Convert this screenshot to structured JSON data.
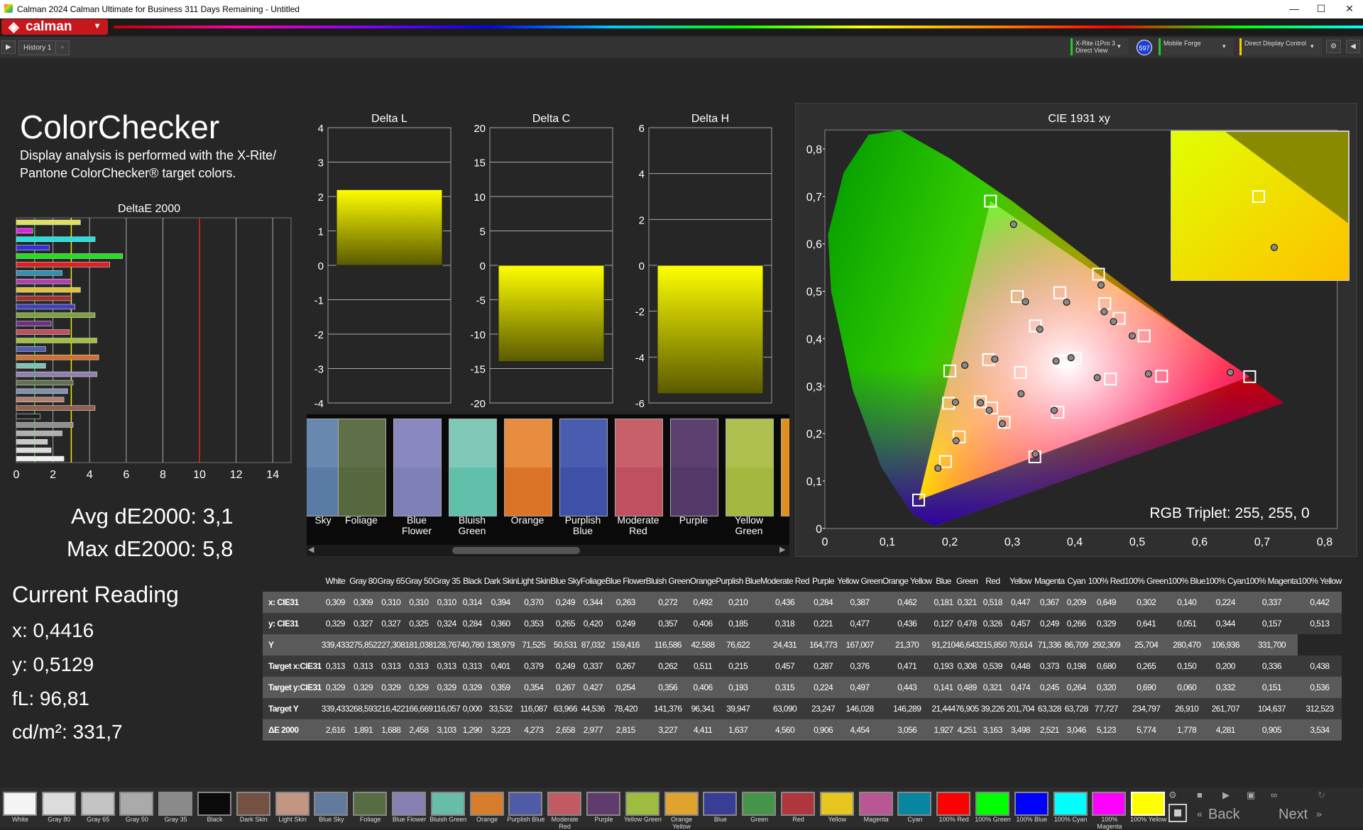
{
  "window": {
    "title": "Calman 2024 Calman Ultimate for Business 311 Days Remaining  - Untitled",
    "minimize": "—",
    "maximize": "☐",
    "close": "✕"
  },
  "app": {
    "logo_text": "calman",
    "history_tab": "History 1",
    "add_tab": "+"
  },
  "devices": {
    "meter_line1": "X-Rite i1Pro 3",
    "meter_line2": "Direct View",
    "meter_badge": "597",
    "source": "Mobile Forge",
    "display": "Direct Display Control"
  },
  "page": {
    "title": "ColorChecker",
    "description_line1": "Display analysis is performed with the X-Rite/",
    "description_line2": "Pantone ColorChecker® target colors.",
    "avg_label": "Avg dE2000: 3,1",
    "max_label": "Max dE2000: 5,8"
  },
  "current_reading": {
    "title": "Current Reading",
    "x": "x: 0,4416",
    "y": "y: 0,5129",
    "fl": "fL: 96,81",
    "cdm2": "cd/m²: 331,7"
  },
  "deltae_chart": {
    "title": "DeltaE 2000",
    "ticks": [
      "0",
      "2",
      "4",
      "6",
      "8",
      "10",
      "12",
      "14"
    ],
    "bars": [
      {
        "value": 3.5,
        "color": "#e0e060"
      },
      {
        "value": 0.9,
        "color": "#e020e0"
      },
      {
        "value": 4.3,
        "color": "#20e0e0"
      },
      {
        "value": 1.8,
        "color": "#3030e0"
      },
      {
        "value": 5.8,
        "color": "#20e020"
      },
      {
        "value": 5.1,
        "color": "#e02020"
      },
      {
        "value": 2.5,
        "color": "#3090b0"
      },
      {
        "value": 3.0,
        "color": "#b040b0"
      },
      {
        "value": 3.5,
        "color": "#e0c040"
      },
      {
        "value": 3.0,
        "color": "#a03030"
      },
      {
        "value": 3.2,
        "color": "#4040c0"
      },
      {
        "value": 4.3,
        "color": "#80a040"
      },
      {
        "value": 1.9,
        "color": "#703080"
      },
      {
        "value": 2.9,
        "color": "#c05060"
      },
      {
        "value": 4.4,
        "color": "#a0c040"
      },
      {
        "value": 1.6,
        "color": "#5060b0"
      },
      {
        "value": 4.5,
        "color": "#d07030"
      },
      {
        "value": 1.6,
        "color": "#80c0b0"
      },
      {
        "value": 4.4,
        "color": "#9080b0"
      },
      {
        "value": 3.1,
        "color": "#607050"
      },
      {
        "value": 2.8,
        "color": "#8090b0"
      },
      {
        "value": 2.6,
        "color": "#b08070"
      },
      {
        "value": 4.3,
        "color": "#906050"
      },
      {
        "value": 1.3,
        "color": "#202020"
      },
      {
        "value": 3.1,
        "color": "#909090"
      },
      {
        "value": 2.5,
        "color": "#b0b0b0"
      },
      {
        "value": 1.7,
        "color": "#c8c8c8"
      },
      {
        "value": 1.9,
        "color": "#dcdcdc"
      },
      {
        "value": 2.6,
        "color": "#f0f0f0"
      }
    ],
    "ref_lines": [
      1,
      3,
      10
    ]
  },
  "chart_data": [
    {
      "type": "bar",
      "title": "Delta L",
      "categories": [
        "100% Yellow"
      ],
      "values": [
        2.2
      ],
      "ylim": [
        -4,
        4
      ],
      "ticks": [
        "4",
        "3",
        "2",
        "1",
        "0",
        "-1",
        "-2",
        "-3",
        "-4"
      ]
    },
    {
      "type": "bar",
      "title": "Delta C",
      "categories": [
        "100% Yellow"
      ],
      "values": [
        -14
      ],
      "ylim": [
        -20,
        20
      ],
      "ticks": [
        "20",
        "15",
        "10",
        "5",
        "0",
        "-5",
        "-10",
        "-15",
        "-20"
      ]
    },
    {
      "type": "bar",
      "title": "Delta H",
      "categories": [
        "100% Yellow"
      ],
      "values": [
        -5.6
      ],
      "ylim": [
        -6,
        6
      ],
      "ticks": [
        "6",
        "4",
        "2",
        "0",
        "-2",
        "-4",
        "-6"
      ]
    },
    {
      "type": "scatter",
      "title": "CIE 1931 xy",
      "xticks": [
        "0",
        "0,1",
        "0,2",
        "0,3",
        "0,4",
        "0,5",
        "0,6",
        "0,7",
        "0,8"
      ],
      "yticks": [
        "0",
        "0,1",
        "0,2",
        "0,3",
        "0,4",
        "0,5",
        "0,6",
        "0,7",
        "0,8"
      ],
      "gamut": [
        [
          0.68,
          0.32
        ],
        [
          0.265,
          0.69
        ],
        [
          0.15,
          0.06
        ]
      ],
      "targets": [
        [
          0.313,
          0.329
        ],
        [
          0.401,
          0.359
        ],
        [
          0.379,
          0.353
        ],
        [
          0.249,
          0.267
        ],
        [
          0.337,
          0.427
        ],
        [
          0.267,
          0.254
        ],
        [
          0.262,
          0.356
        ],
        [
          0.511,
          0.406
        ],
        [
          0.215,
          0.193
        ],
        [
          0.457,
          0.315
        ],
        [
          0.287,
          0.224
        ],
        [
          0.376,
          0.497
        ],
        [
          0.471,
          0.443
        ],
        [
          0.193,
          0.141
        ],
        [
          0.308,
          0.489
        ],
        [
          0.539,
          0.321
        ],
        [
          0.448,
          0.474
        ],
        [
          0.373,
          0.245
        ],
        [
          0.198,
          0.264
        ],
        [
          0.68,
          0.32
        ],
        [
          0.265,
          0.69
        ],
        [
          0.15,
          0.06
        ],
        [
          0.2,
          0.332
        ],
        [
          0.336,
          0.151
        ],
        [
          0.438,
          0.536
        ]
      ],
      "measured": [
        [
          0.314,
          0.284
        ],
        [
          0.394,
          0.36
        ],
        [
          0.37,
          0.353
        ],
        [
          0.249,
          0.265
        ],
        [
          0.344,
          0.42
        ],
        [
          0.263,
          0.249
        ],
        [
          0.272,
          0.357
        ],
        [
          0.492,
          0.406
        ],
        [
          0.21,
          0.185
        ],
        [
          0.436,
          0.318
        ],
        [
          0.284,
          0.221
        ],
        [
          0.387,
          0.477
        ],
        [
          0.462,
          0.436
        ],
        [
          0.181,
          0.127
        ],
        [
          0.321,
          0.478
        ],
        [
          0.518,
          0.326
        ],
        [
          0.447,
          0.457
        ],
        [
          0.367,
          0.249
        ],
        [
          0.209,
          0.266
        ],
        [
          0.649,
          0.329
        ],
        [
          0.302,
          0.641
        ],
        [
          0.224,
          0.344
        ],
        [
          0.337,
          0.157
        ],
        [
          0.442,
          0.513
        ]
      ],
      "rgb_triplet": "RGB Triplet: 255, 255, 0"
    }
  ],
  "swatch_strip": [
    {
      "label1": "Sky",
      "label2": "",
      "top": "#6888b0",
      "bottom": "#5a7ca4"
    },
    {
      "label1": "Foliage",
      "label2": "",
      "top": "#5e7048",
      "bottom": "#56683e"
    },
    {
      "label1": "Blue",
      "label2": "Flower",
      "top": "#8a88c0",
      "bottom": "#7e80b8"
    },
    {
      "label1": "Bluish",
      "label2": "Green",
      "top": "#80c8b8",
      "bottom": "#60c0aa"
    },
    {
      "label1": "Orange",
      "label2": "",
      "top": "#e88c40",
      "bottom": "#dc7428"
    },
    {
      "label1": "Purplish",
      "label2": "Blue",
      "top": "#4a5cb0",
      "bottom": "#3e50a8"
    },
    {
      "label1": "Moderate",
      "label2": "Red",
      "top": "#c8606a",
      "bottom": "#c05060"
    },
    {
      "label1": "Purple",
      "label2": "",
      "top": "#5e4070",
      "bottom": "#543868"
    },
    {
      "label1": "Yellow",
      "label2": "Green",
      "top": "#b0c050",
      "bottom": "#a4b840"
    }
  ],
  "table": {
    "columns": [
      "White",
      "Gray 80",
      "Gray 65",
      "Gray 50",
      "Gray 35",
      "Black",
      "Dark Skin",
      "Light Skin",
      "Blue Sky",
      "Foliage",
      "Blue Flower",
      "Bluish Green",
      "Orange",
      "Purplish Blue",
      "Moderate Red",
      "Purple",
      "Yellow Green",
      "Orange Yellow",
      "Blue",
      "Green",
      "Red",
      "Yellow",
      "Magenta",
      "Cyan",
      "100% Red",
      "100% Green",
      "100% Blue",
      "100% Cyan",
      "100% Magenta",
      "100% Yellow"
    ],
    "rows": [
      {
        "label": "x: CIE31",
        "values": [
          "0,309",
          "0,309",
          "0,310",
          "0,310",
          "0,310",
          "0,314",
          "0,394",
          "0,370",
          "0,249",
          "0,344",
          "0,263",
          "0,272",
          "0,492",
          "0,210",
          "0,436",
          "0,284",
          "0,387",
          "0,462",
          "0,181",
          "0,321",
          "0,518",
          "0,447",
          "0,367",
          "0,209",
          "0,649",
          "0,302",
          "0,140",
          "0,224",
          "0,337",
          "0,442"
        ]
      },
      {
        "label": "y: CIE31",
        "values": [
          "0,329",
          "0,327",
          "0,327",
          "0,325",
          "0,324",
          "0,284",
          "0,360",
          "0,353",
          "0,265",
          "0,420",
          "0,249",
          "0,357",
          "0,406",
          "0,185",
          "0,318",
          "0,221",
          "0,477",
          "0,436",
          "0,127",
          "0,478",
          "0,326",
          "0,457",
          "0,249",
          "0,266",
          "0,329",
          "0,641",
          "0,051",
          "0,344",
          "0,157",
          "0,513"
        ]
      },
      {
        "label": "Y",
        "values": [
          "339,433",
          "275,852",
          "227,308",
          "181,038",
          "128,767",
          "40,780",
          "138,979",
          "71,525",
          "50,531",
          "87,032",
          "159,416",
          "116,586",
          "42,588",
          "76,622",
          "24,431",
          "164,773",
          "167,007",
          "21,370",
          "91,210",
          "46,643",
          "215,850",
          "70,614",
          "71,336",
          "86,709",
          "292,309",
          "25,704",
          "280,470",
          "106,936",
          "331,700"
        ]
      },
      {
        "label": "Target x:CIE31",
        "values": [
          "0,313",
          "0,313",
          "0,313",
          "0,313",
          "0,313",
          "0,313",
          "0,401",
          "0,379",
          "0,249",
          "0,337",
          "0,267",
          "0,262",
          "0,511",
          "0,215",
          "0,457",
          "0,287",
          "0,376",
          "0,471",
          "0,193",
          "0,308",
          "0,539",
          "0,448",
          "0,373",
          "0,198",
          "0,680",
          "0,265",
          "0,150",
          "0,200",
          "0,336",
          "0,438"
        ]
      },
      {
        "label": "Target y:CIE31",
        "values": [
          "0,329",
          "0,329",
          "0,329",
          "0,329",
          "0,329",
          "0,329",
          "0,359",
          "0,354",
          "0,267",
          "0,427",
          "0,254",
          "0,356",
          "0,406",
          "0,193",
          "0,315",
          "0,224",
          "0,497",
          "0,443",
          "0,141",
          "0,489",
          "0,321",
          "0,474",
          "0,245",
          "0,264",
          "0,320",
          "0,690",
          "0,060",
          "0,332",
          "0,151",
          "0,536"
        ]
      },
      {
        "label": "Target Y",
        "values": [
          "339,433",
          "268,593",
          "216,422",
          "166,669",
          "116,057",
          "0,000",
          "33,532",
          "116,087",
          "63,966",
          "44,536",
          "78,420",
          "141,376",
          "96,341",
          "39,947",
          "63,090",
          "23,247",
          "146,028",
          "146,289",
          "21,444",
          "76,905",
          "39,226",
          "201,704",
          "63,328",
          "63,728",
          "77,727",
          "234,797",
          "26,910",
          "261,707",
          "104,637",
          "312,523"
        ]
      },
      {
        "label": "ΔE 2000",
        "values": [
          "2,616",
          "1,891",
          "1,688",
          "2,458",
          "3,103",
          "1,290",
          "3,223",
          "4,273",
          "2,658",
          "2,977",
          "2,815",
          "3,227",
          "4,411",
          "1,637",
          "4,560",
          "0,906",
          "4,454",
          "3,056",
          "1,927",
          "4,251",
          "3,163",
          "3,498",
          "2,521",
          "3,046",
          "5,123",
          "5,774",
          "1,778",
          "4,281",
          "0,905",
          "3,534"
        ]
      }
    ]
  },
  "bottom_swatches": [
    {
      "label": "White",
      "color": "#f4f4f4"
    },
    {
      "label": "Gray 80",
      "color": "#dcdcdc"
    },
    {
      "label": "Gray 65",
      "color": "#c4c4c4"
    },
    {
      "label": "Gray 50",
      "color": "#aaaaaa"
    },
    {
      "label": "Gray 35",
      "color": "#8a8a8a"
    },
    {
      "label": "Black",
      "color": "#0a0a0a"
    },
    {
      "label": "Dark Skin",
      "color": "#735244"
    },
    {
      "label": "Light Skin",
      "color": "#c29682"
    },
    {
      "label": "Blue Sky",
      "color": "#627a9d"
    },
    {
      "label": "Foliage",
      "color": "#576c43"
    },
    {
      "label": "Blue Flower",
      "color": "#8580b1"
    },
    {
      "label": "Bluish Green",
      "color": "#67bdaa"
    },
    {
      "label": "Orange",
      "color": "#d67e2c"
    },
    {
      "label": "Purplish Blue",
      "color": "#505ba6"
    },
    {
      "label": "Moderate Red",
      "color": "#c15a63"
    },
    {
      "label": "Purple",
      "color": "#5e3c6c"
    },
    {
      "label": "Yellow Green",
      "color": "#9dbc40"
    },
    {
      "label": "Orange Yellow",
      "color": "#e0a32e"
    },
    {
      "label": "Blue",
      "color": "#383d96"
    },
    {
      "label": "Green",
      "color": "#469449"
    },
    {
      "label": "Red",
      "color": "#af363c"
    },
    {
      "label": "Yellow",
      "color": "#e7c71f"
    },
    {
      "label": "Magenta",
      "color": "#bb5695"
    },
    {
      "label": "Cyan",
      "color": "#0885a1"
    },
    {
      "label": "100% Red",
      "color": "#ff0000"
    },
    {
      "label": "100% Green",
      "color": "#00ff00"
    },
    {
      "label": "100% Blue",
      "color": "#0000ff"
    },
    {
      "label": "100% Cyan",
      "color": "#00ffff"
    },
    {
      "label": "100% Magenta",
      "color": "#ff00ff"
    },
    {
      "label": "100% Yellow",
      "color": "#ffff00"
    }
  ],
  "nav": {
    "back": "Back",
    "next": "Next"
  }
}
